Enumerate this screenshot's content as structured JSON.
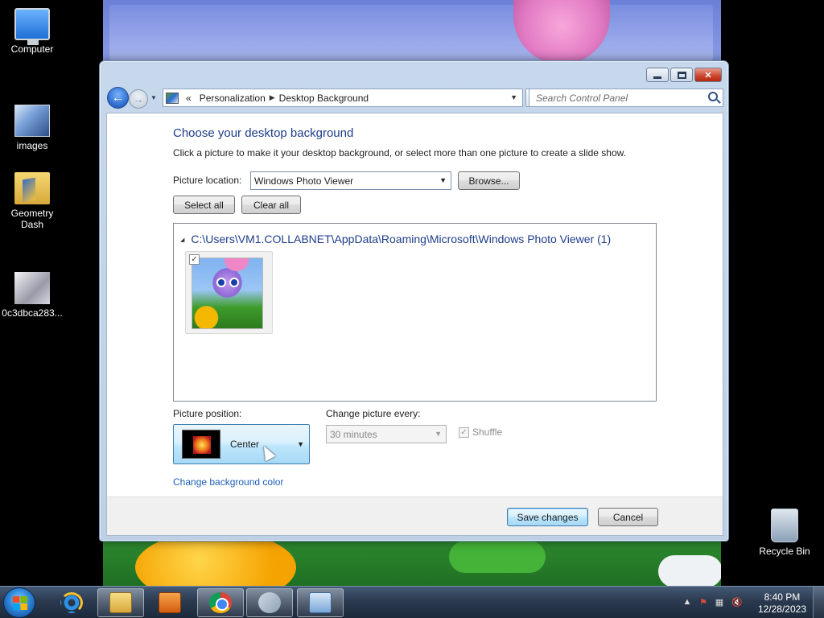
{
  "desktop": {
    "icons": [
      {
        "label": "Computer",
        "icon": "computer-icon"
      },
      {
        "label": "images",
        "icon": "image-file-icon"
      },
      {
        "label": "Geometry Dash",
        "icon": "folder-icon"
      },
      {
        "label": "0c3dbca283...",
        "icon": "image-file-icon"
      },
      {
        "label": "Recycle Bin",
        "icon": "recycle-bin-icon"
      }
    ]
  },
  "window": {
    "breadcrumb": {
      "overflow": "«",
      "items": [
        "Personalization",
        "Desktop Background"
      ]
    },
    "search_placeholder": "Search Control Panel",
    "title": "Choose your desktop background",
    "subtitle": "Click a picture to make it your desktop background, or select more than one picture to create a slide show.",
    "picture_location": {
      "label": "Picture location:",
      "value": "Windows Photo Viewer",
      "browse_label": "Browse..."
    },
    "select_all_label": "Select all",
    "clear_all_label": "Clear all",
    "gallery": {
      "group_title": "C:\\Users\\VM1.COLLABNET\\AppData\\Roaming\\Microsoft\\Windows Photo Viewer (1)",
      "items": [
        {
          "checked": true
        }
      ]
    },
    "picture_position": {
      "label": "Picture position:",
      "value": "Center"
    },
    "change_every": {
      "label": "Change picture every:",
      "value": "30 minutes",
      "enabled": false
    },
    "shuffle": {
      "label": "Shuffle",
      "checked": true,
      "enabled": false
    },
    "change_bg_color_label": "Change background color",
    "save_label": "Save changes",
    "cancel_label": "Cancel"
  },
  "taskbar": {
    "apps": [
      "internet-explorer-icon",
      "file-explorer-icon",
      "media-player-icon",
      "chrome-icon",
      "paint-icon",
      "control-panel-icon"
    ],
    "clock": {
      "time": "8:40 PM",
      "date": "12/28/2023"
    }
  },
  "colors": {
    "title_text": "#1e3d8a",
    "link_text": "#1e5eb8",
    "primary_button_border": "#3c7fb1"
  }
}
